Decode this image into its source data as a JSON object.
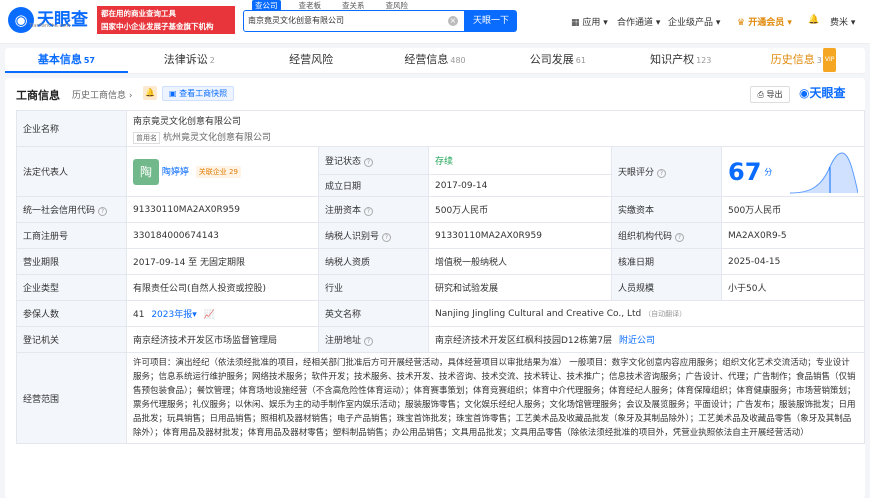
{
  "header": {
    "logo_text": "天眼查",
    "logo_sub": "TianYanCha.com",
    "slogan_line1": "都在用的商业查询工具",
    "slogan_line2": "国家中小企业发展子基金旗下机构",
    "search_tabs": [
      "查公司",
      "查老板",
      "查关系",
      "查风险"
    ],
    "search_value": "南京竟灵文化创意有限公司",
    "search_button": "天眼一下",
    "nav": [
      "应用",
      "合作通道",
      "企业级产品",
      "开通会员",
      "费米"
    ]
  },
  "tabs": [
    {
      "label": "基本信息",
      "count": "57"
    },
    {
      "label": "法律诉讼",
      "count": "2"
    },
    {
      "label": "经营风险",
      "count": ""
    },
    {
      "label": "经营信息",
      "count": "480"
    },
    {
      "label": "公司发展",
      "count": "61"
    },
    {
      "label": "知识产权",
      "count": "123"
    },
    {
      "label": "历史信息",
      "count": "31"
    }
  ],
  "vip_badge": "VIP",
  "panel": {
    "title": "工商信息",
    "history_link": "历史工商信息",
    "snapshot_button": "查看工商快照",
    "export_button": "导出",
    "brand": "天眼查"
  },
  "info": {
    "name_label": "企业名称",
    "name_value": "南京竟灵文化创意有限公司",
    "former_tag": "曾用名",
    "former_value": "杭州竟灵文化创意有限公司",
    "legal_label": "法定代表人",
    "legal_avatar": "陶",
    "legal_name": "陶婷婷",
    "legal_assoc": "关联企业 29",
    "status_label": "登记状态",
    "status_value": "存续",
    "found_label": "成立日期",
    "found_value": "2017-09-14",
    "score_label": "天眼评分",
    "score_value": "67",
    "score_unit": "分",
    "credit_label": "统一社会信用代码",
    "credit_value": "91330110MA2AX0R959",
    "capital_label": "注册资本",
    "capital_value": "500万人民币",
    "paid_label": "实缴资本",
    "paid_value": "500万人民币",
    "reg_label": "工商注册号",
    "reg_value": "330184000674143",
    "tax_label": "纳税人识别号",
    "tax_value": "91330110MA2AX0R959",
    "org_label": "组织机构代码",
    "org_value": "MA2AX0R9-5",
    "term_label": "营业期限",
    "term_value": "2017-09-14 至 无固定期限",
    "taxq_label": "纳税人资质",
    "taxq_value": "增值税一般纳税人",
    "approve_label": "核准日期",
    "approve_value": "2025-04-15",
    "type_label": "企业类型",
    "type_value": "有限责任公司(自然人投资或控股)",
    "industry_label": "行业",
    "industry_value": "研究和试验发展",
    "staff_label": "人员规模",
    "staff_value": "小于50人",
    "insured_label": "参保人数",
    "insured_value": "41",
    "insured_year": "2023年报",
    "en_label": "英文名称",
    "en_value": "Nanjing Jingling Cultural and Creative Co., Ltd",
    "en_note": "（自动翻译）",
    "authority_label": "登记机关",
    "authority_value": "南京经济技术开发区市场监督管理局",
    "addr_label": "注册地址",
    "addr_value": "南京经济技术开发区红枫科技园D12栋第7层",
    "addr_link": "附近公司",
    "scope_label": "经营范围",
    "scope_value": "许可项目：演出经纪（依法须经批准的项目，经相关部门批准后方可开展经营活动，具体经营项目以审批结果为准） 一般项目：数字文化创意内容应用服务；组织文化艺术交流活动；专业设计服务；信息系统运行维护服务；网络技术服务；软件开发；技术服务、技术开发、技术咨询、技术交流、技术转让、技术推广；信息技术咨询服务；广告设计、代理；广告制作；食品销售（仅销售预包装食品）；餐饮管理；体育场地设施经营（不含高危险性体育运动）；体育赛事策划；体育竞赛组织；体育中介代理服务；体育经纪人服务；体育保障组织；体育健康服务；市场营销策划；票务代理服务；礼仪服务；以休闲、娱乐为主的动手制作室内娱乐活动；服装服饰零售；文化娱乐经纪人服务；文化场馆管理服务；会议及展览服务；平面设计；广告发布；服装服饰批发；日用品批发；玩具销售；日用品销售；照相机及器材销售；电子产品销售；珠宝首饰批发；珠宝首饰零售；工艺美术品及收藏品批发（象牙及其制品除外）；工艺美术品及收藏品零售（象牙及其制品除外）；体育用品及器材批发；体育用品及器材零售；塑料制品销售；办公用品销售；文具用品批发；文具用品零售（除依法须经批准的项目外，凭营业执照依法自主开展经营活动）"
  }
}
